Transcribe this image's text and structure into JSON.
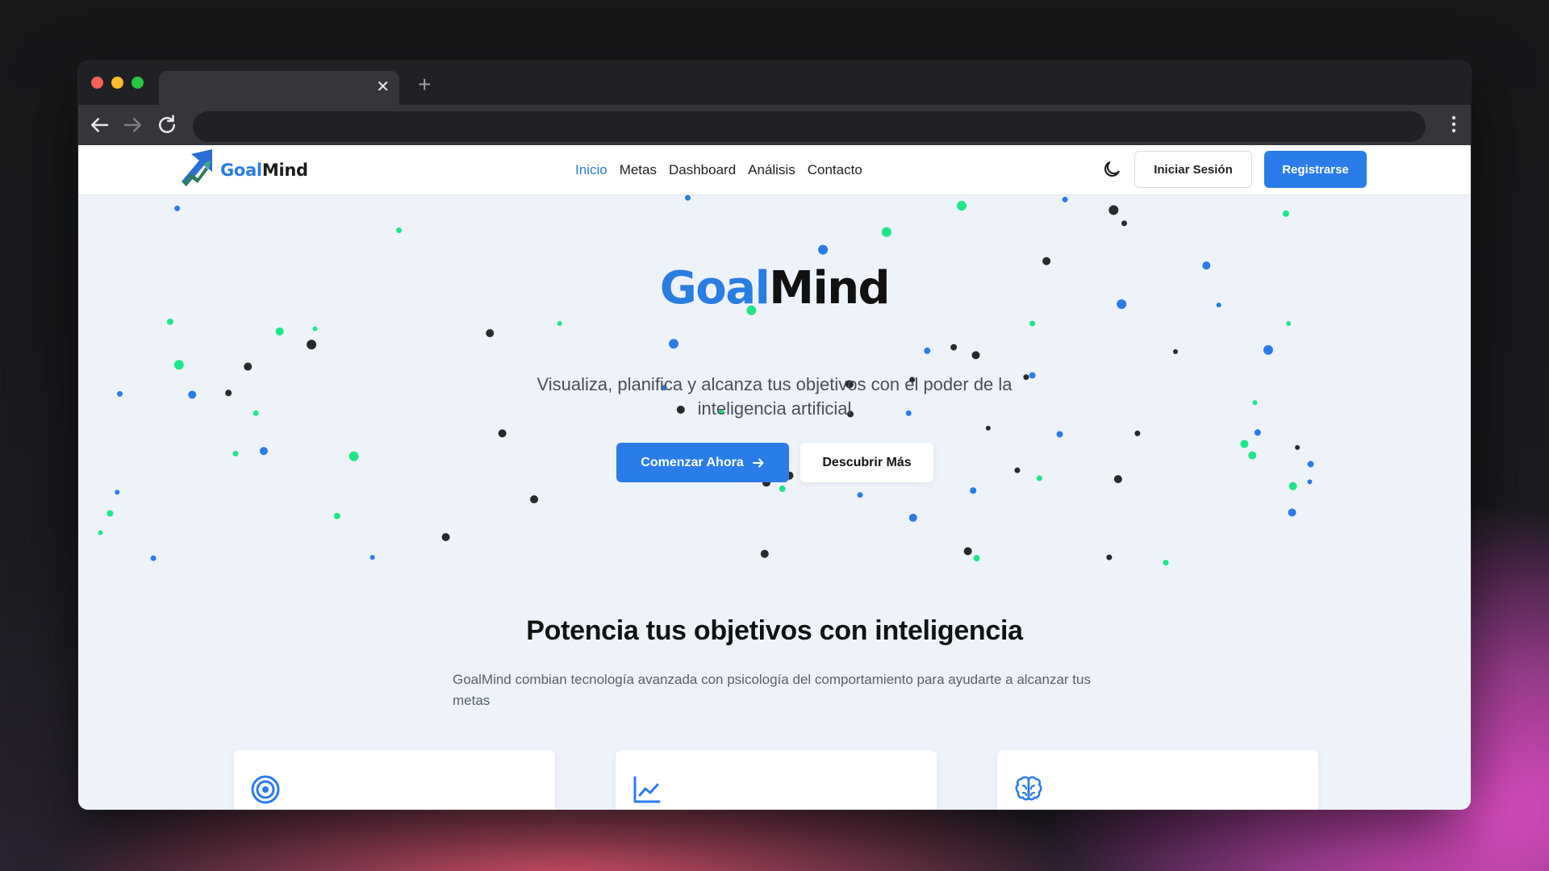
{
  "browser": {
    "tab_close": "✕",
    "new_tab": "+"
  },
  "site": {
    "logo": {
      "part1": "Goal",
      "part2": "Mind"
    },
    "nav": [
      "Inicio",
      "Metas",
      "Dashboard",
      "Análisis",
      "Contacto"
    ],
    "active_nav": "Inicio",
    "login_label": "Iniciar Sesión",
    "register_label": "Registrarse"
  },
  "hero": {
    "title_part1": "Goal",
    "title_part2": "Mind",
    "subtitle": "Visualiza, planifica y alcanza tus objetivos con el poder de la inteligencia artificial",
    "primary_button": "Comenzar Ahora",
    "secondary_button": "Descubrir Más"
  },
  "features": {
    "title": "Potencia tus objetivos con inteligencia",
    "subtitle": "GoalMind combian tecnología avanzada con psicología del comportamiento para ayudarte a alcanzar tus metas",
    "cards": [
      {
        "icon": "target-icon"
      },
      {
        "icon": "line-chart-icon"
      },
      {
        "icon": "brain-icon"
      }
    ]
  },
  "colors": {
    "accent_blue": "#2a7ce8",
    "particle_green": "#1ee68a",
    "particle_dark": "#2a2a2a"
  }
}
